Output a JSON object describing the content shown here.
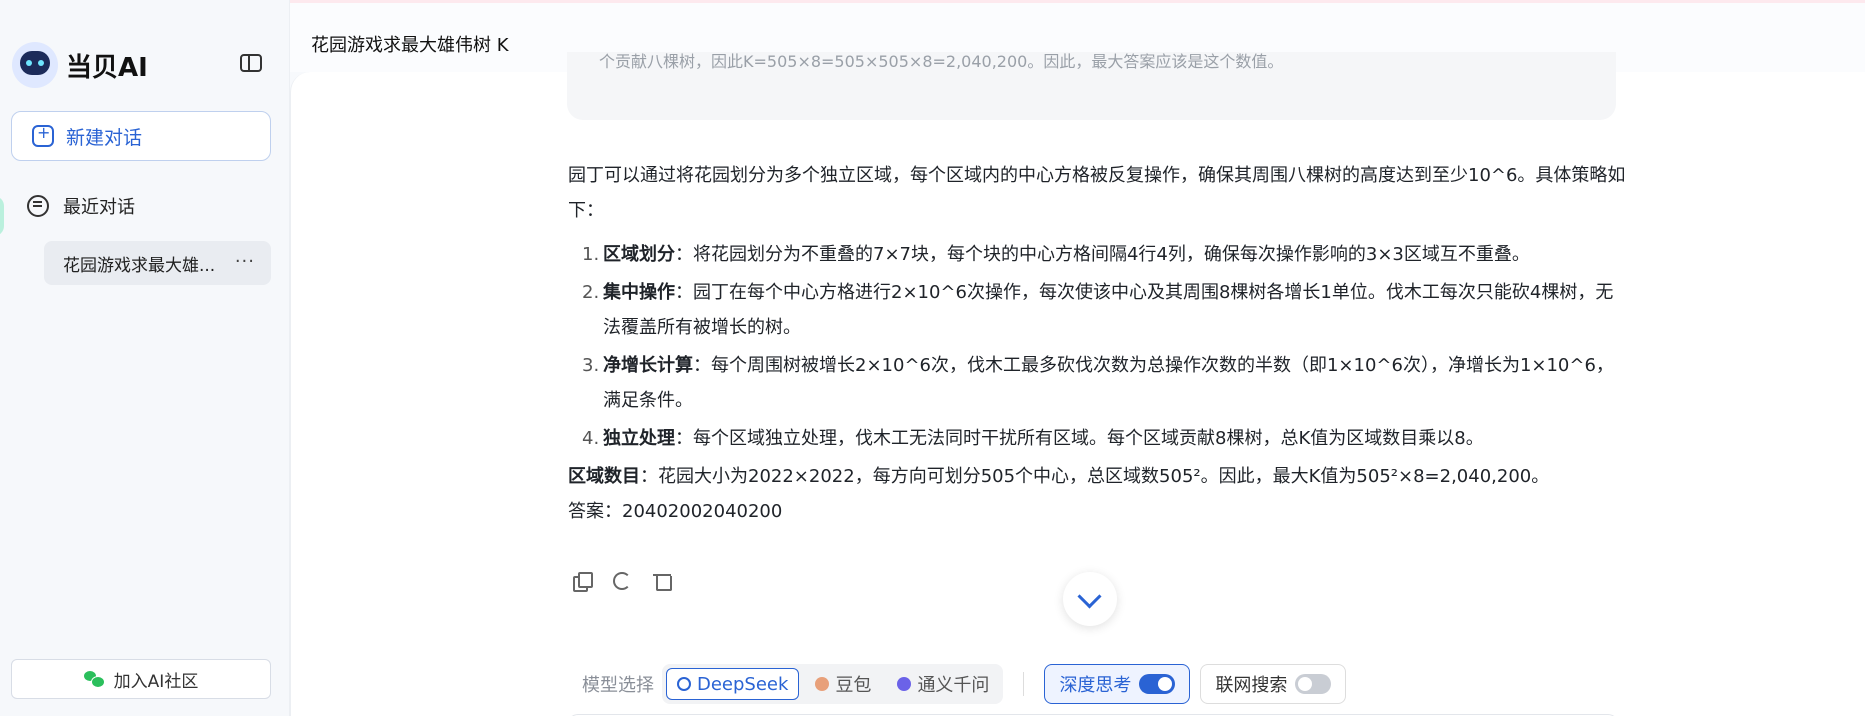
{
  "app": {
    "name": "当贝AI"
  },
  "sidebar": {
    "new_chat_label": "新建对话",
    "recent_label": "最近对话",
    "chats": [
      {
        "label": "花园游戏求最大雄..."
      }
    ],
    "community_label": "加入AI社区"
  },
  "header": {
    "title": "花园游戏求最大雄伟树 K"
  },
  "conversation": {
    "quote_fragment": "个贡献八棵树，因此K=505×8=505×505×8=2,040,200。因此，最大答案应该是这个数值。",
    "intro": "园丁可以通过将花园划分为多个独立区域，每个区域内的中心方格被反复操作，确保其周围八棵树的高度达到至少10^6。具体策略如下：",
    "steps": [
      {
        "num": "1.",
        "title": "区域划分",
        "text": "：将花园划分为不重叠的7×7块，每个块的中心方格间隔4行4列，确保每次操作影响的3×3区域互不重叠。"
      },
      {
        "num": "2.",
        "title": "集中操作",
        "text": "：园丁在每个中心方格进行2×10^6次操作，每次使该中心及其周围8棵树各增长1单位。伐木工每次只能砍4棵树，无法覆盖所有被增长的树。"
      },
      {
        "num": "3.",
        "title": "净增长计算",
        "text": "：每个周围树被增长2×10^6次，伐木工最多砍伐次数为总操作次数的半数（即1×10^6次），净增长为1×10^6，满足条件。"
      },
      {
        "num": "4.",
        "title": "独立处理",
        "text": "：每个区域独立处理，伐木工无法同时干扰所有区域。每个区域贡献8棵树，总K值为区域数目乘以8。"
      }
    ],
    "region_title": "区域数目",
    "region_text": "：花园大小为2022×2022，每方向可划分505个中心，总区域数505²。因此，最大K值为505²×8=2,040,200。",
    "answer_label": "答案：",
    "answer_value": "20402002040200"
  },
  "composer": {
    "model_label": "模型选择",
    "models": [
      {
        "label": "DeepSeek",
        "active": true
      },
      {
        "label": "豆包",
        "active": false
      },
      {
        "label": "通义千问",
        "active": false
      }
    ],
    "deep_think_label": "深度思考",
    "deep_think_on": true,
    "web_search_label": "联网搜索",
    "web_search_on": false
  },
  "colors": {
    "accent": "#2a63d4",
    "sidebar_bg": "#f6f8fb",
    "quote_bg": "#f5f6f8"
  }
}
